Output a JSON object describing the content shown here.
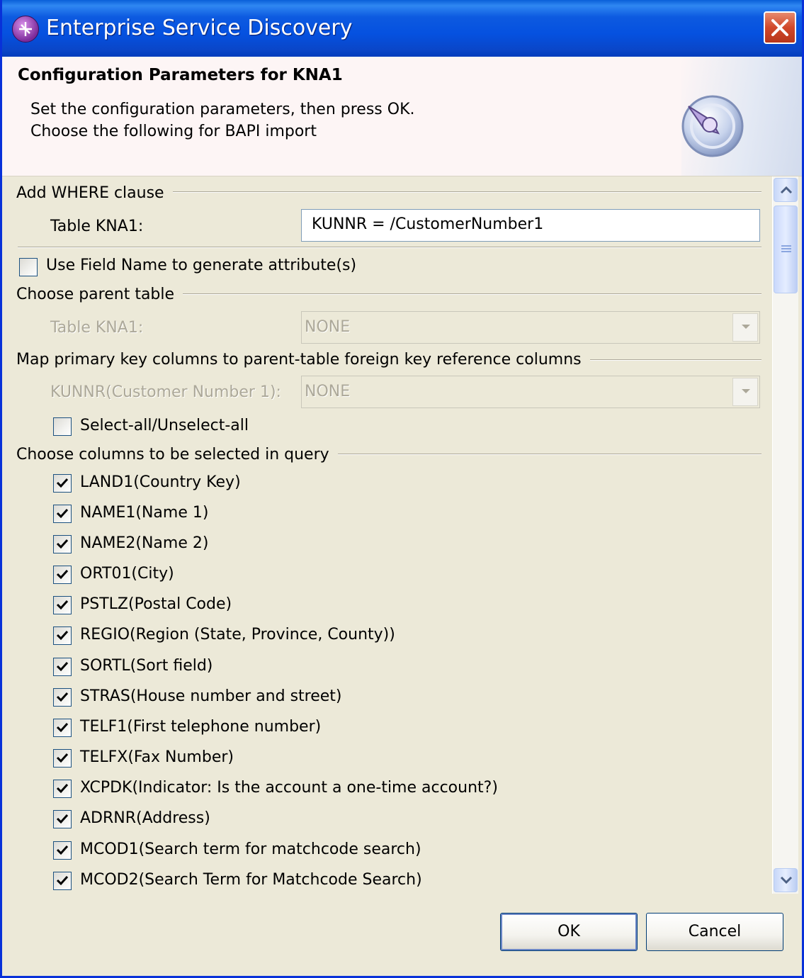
{
  "window": {
    "title": "Enterprise Service Discovery"
  },
  "banner": {
    "title": "Configuration Parameters for KNA1",
    "line1": "Set the configuration parameters, then press OK.",
    "line2": "Choose the following for BAPI import"
  },
  "where_clause": {
    "group_title": "Add WHERE clause",
    "table_label": "Table KNA1:",
    "value": "KUNNR = /CustomerNumber1"
  },
  "use_field_name": {
    "label": "Use Field Name to generate attribute(s)",
    "checked": false
  },
  "parent_table": {
    "group_title": "Choose parent table",
    "table_label": "Table KNA1:",
    "selected": "NONE"
  },
  "key_mapping": {
    "group_title": "Map primary key columns to parent-table foreign key reference columns",
    "column_label": "KUNNR(Customer Number 1):",
    "selected": "NONE",
    "select_all_label": "Select-all/Unselect-all",
    "select_all_checked": false
  },
  "columns": {
    "group_title": "Choose columns to be selected in query",
    "items": [
      {
        "label": "LAND1(Country Key)",
        "checked": true
      },
      {
        "label": "NAME1(Name 1)",
        "checked": true
      },
      {
        "label": "NAME2(Name 2)",
        "checked": true
      },
      {
        "label": "ORT01(City)",
        "checked": true
      },
      {
        "label": "PSTLZ(Postal Code)",
        "checked": true
      },
      {
        "label": "REGIO(Region (State, Province, County))",
        "checked": true
      },
      {
        "label": "SORTL(Sort field)",
        "checked": true
      },
      {
        "label": "STRAS(House number and street)",
        "checked": true
      },
      {
        "label": "TELF1(First telephone number)",
        "checked": true
      },
      {
        "label": "TELFX(Fax Number)",
        "checked": true
      },
      {
        "label": "XCPDK(Indicator: Is the account a one-time account?)",
        "checked": true
      },
      {
        "label": "ADRNR(Address)",
        "checked": true
      },
      {
        "label": "MCOD1(Search term for matchcode search)",
        "checked": true
      },
      {
        "label": "MCOD2(Search Term for Matchcode Search)",
        "checked": true
      }
    ]
  },
  "buttons": {
    "ok": "OK",
    "cancel": "Cancel"
  }
}
